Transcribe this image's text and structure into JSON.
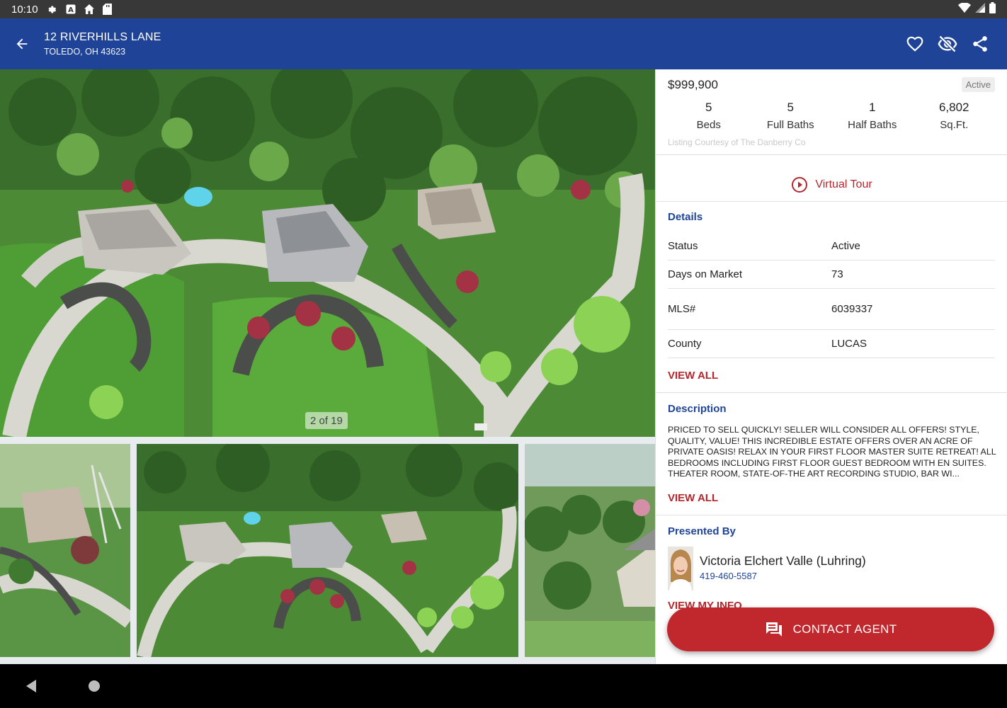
{
  "status_bar": {
    "time": "10:10",
    "left_icons": [
      "gear-icon",
      "a-box-icon",
      "home-icon",
      "sd-card-icon"
    ],
    "right_icons": [
      "wifi-icon",
      "signal-icon",
      "battery-icon"
    ]
  },
  "app_bar": {
    "title": "12 RIVERHILLS LANE",
    "subtitle": "TOLEDO, OH 43623",
    "actions": [
      "favorite-icon",
      "hide-icon",
      "share-icon"
    ],
    "color": "#1f4497"
  },
  "gallery": {
    "counter": "2 of 19"
  },
  "listing": {
    "price": "$999,900",
    "status_badge": "Active",
    "stats": [
      {
        "value": "5",
        "label": "Beds"
      },
      {
        "value": "5",
        "label": "Full Baths"
      },
      {
        "value": "1",
        "label": "Half Baths"
      },
      {
        "value": "6,802",
        "label": "Sq.Ft."
      }
    ],
    "courtesy": "Listing Courtesy of The Danberry Co",
    "virtual_tour": "Virtual Tour"
  },
  "details": {
    "title": "Details",
    "rows": [
      {
        "key": "Status",
        "value": "Active"
      },
      {
        "key": "Days on Market",
        "value": "73"
      },
      {
        "key": "MLS#",
        "value": "6039337"
      },
      {
        "key": "County",
        "value": "LUCAS"
      }
    ],
    "view_all": "VIEW ALL"
  },
  "description": {
    "title": "Description",
    "text": "PRICED TO SELL QUICKLY! SELLER WILL CONSIDER ALL OFFERS! STYLE, QUALITY, VALUE! THIS INCREDIBLE ESTATE OFFERS OVER AN ACRE OF PRIVATE OASIS! RELAX IN YOUR FIRST FLOOR MASTER SUITE RETREAT! ALL BEDROOMS INCLUDING FIRST FLOOR GUEST BEDROOM WITH EN SUITES. THEATER ROOM, STATE-OF-THE ART RECORDING STUDIO,  BAR WI...",
    "view_all": "VIEW ALL"
  },
  "presented_by": {
    "title": "Presented By",
    "agent_name": "Victoria Elchert Valle (Luhring)",
    "agent_phone": "419-460-5587",
    "view_info": "VIEW MY INFO"
  },
  "contact_button": "CONTACT AGENT",
  "accent_colors": {
    "brand_blue": "#1f4497",
    "action_red": "#c0282e"
  }
}
